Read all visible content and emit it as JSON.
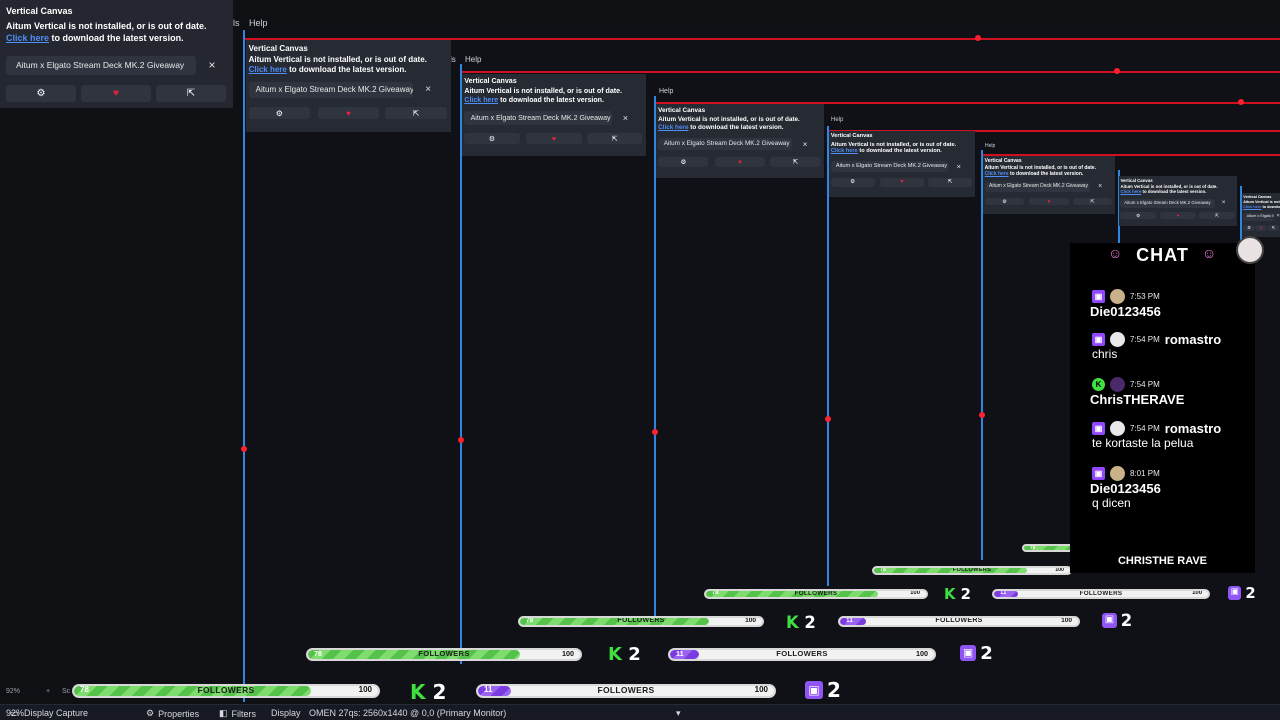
{
  "menu": {
    "item_partial": "ls",
    "help": "Help"
  },
  "dock": {
    "title": "Vertical Canvas",
    "warning": "Aitum Vertical is not installed, or is out of date.",
    "link_text": "Click here",
    "link_rest": "to download the latest version.",
    "giveaway": "Aitum x Elgato Stream Deck MK.2 Giveaway",
    "close": "×",
    "btn_settings": "⚙",
    "btn_heart": "♥",
    "btn_share": "⇱"
  },
  "statusbar": {
    "zoom": "92%",
    "plus": "+",
    "scale_partial": "Sc",
    "source": "Display Capture",
    "properties": "Properties",
    "filters": "Filters",
    "display_label": "Display",
    "display_value": "OMEN 27qs: 2560x1440 @ 0,0 (Primary Monitor)",
    "dropdown": "▾"
  },
  "followers": {
    "green_count": "78",
    "label": "FOLLOWERS",
    "goal": "100",
    "purple_count": "11",
    "green_fraction": 0.78,
    "purple_fraction": 0.11
  },
  "badges": {
    "kick_letter": "K",
    "kick_count": "2",
    "twitch_count": "2"
  },
  "chat": {
    "title": "CHAT",
    "footer": "CHRISTHE RAVE",
    "messages": [
      {
        "platform": "twitch",
        "time": "7:53 PM",
        "user": "Die0123456",
        "text": "",
        "avatar": "tan"
      },
      {
        "platform": "twitch",
        "time": "7:54 PM",
        "user": "romastro",
        "text": "chris",
        "avatar": "white"
      },
      {
        "platform": "kick",
        "time": "7:54 PM",
        "user": "ChrisTHERAVE",
        "text": "",
        "avatar": "purple"
      },
      {
        "platform": "twitch",
        "time": "7:54 PM",
        "user": "romastro",
        "text": "te kortaste la pelua",
        "avatar": "white"
      },
      {
        "platform": "twitch",
        "time": "8:01 PM",
        "user": "Die0123456",
        "text": "q dicen",
        "avatar": "tan"
      }
    ]
  },
  "colors": {
    "accent_blue": "#2f86e0",
    "red_line": "#d01020",
    "kick_green": "#3fe03f",
    "twitch_purple": "#9146ff"
  }
}
